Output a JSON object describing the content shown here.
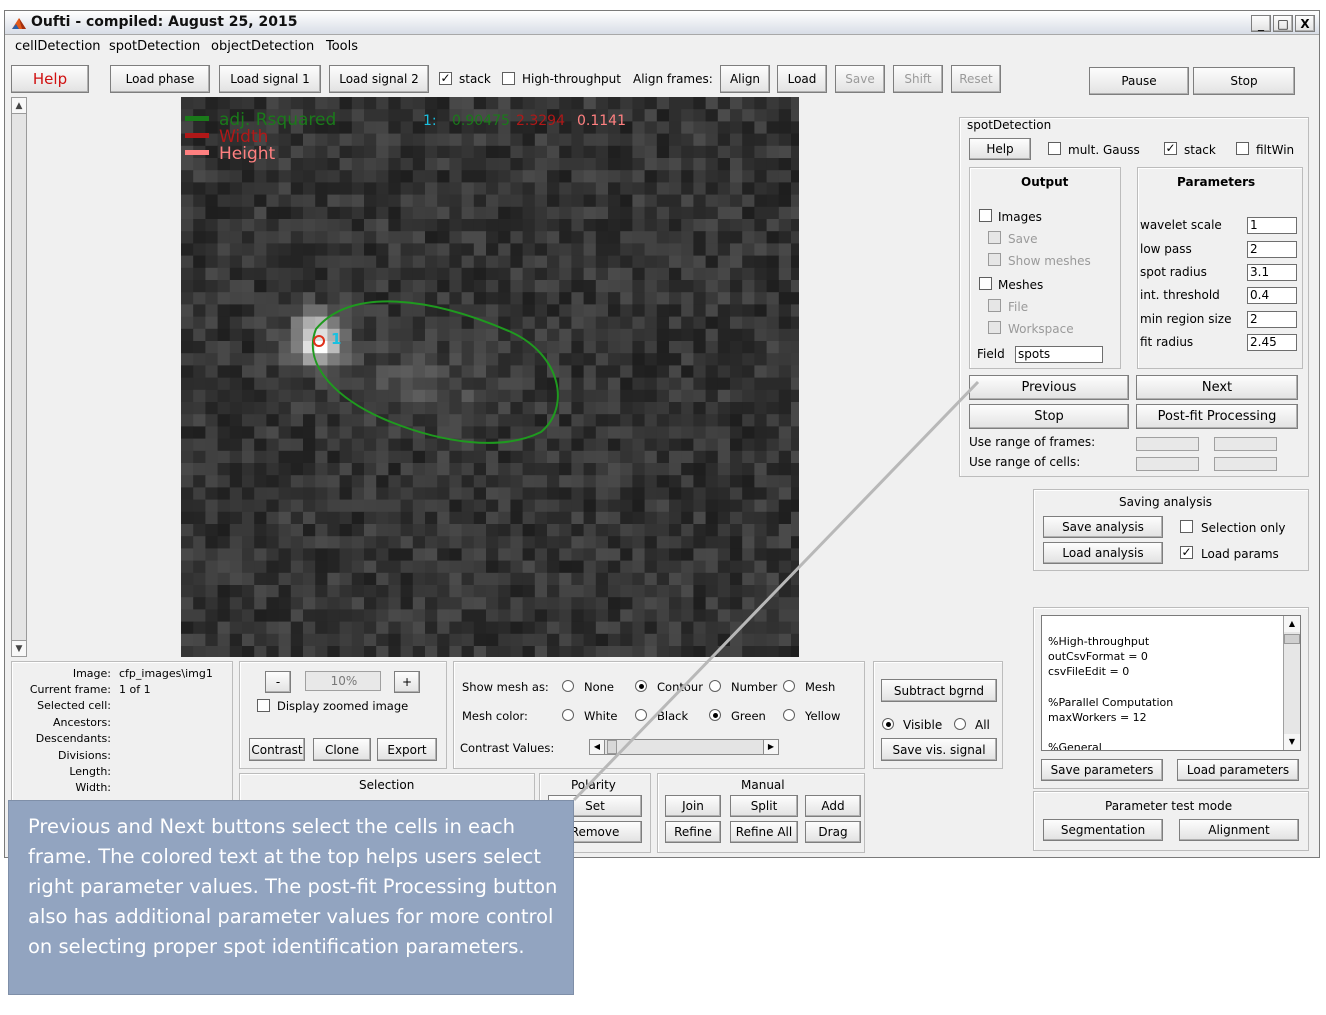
{
  "window": {
    "title": "Oufti - compiled:  August 25, 2015",
    "controls": {
      "minimize": "_",
      "maximize": "□",
      "close": "X"
    }
  },
  "menu": [
    "cellDetection",
    "spotDetection",
    "objectDetection",
    "Tools"
  ],
  "toolbar": {
    "help": "Help",
    "load_phase": "Load phase",
    "load_signal1": "Load signal 1",
    "load_signal2": "Load signal 2",
    "stack_label": "stack",
    "stack_checked": true,
    "high_throughput_label": "High-throughput",
    "high_throughput_checked": false,
    "align_frames_label": "Align frames:",
    "align": "Align",
    "load": "Load",
    "save": "Save",
    "shift": "Shift",
    "reset": "Reset",
    "pause": "Pause",
    "stop": "Stop"
  },
  "overlay": {
    "legend": [
      "adj. Rsquared",
      "Width",
      "Height"
    ],
    "legend_colors": [
      "#1a7a1a",
      "#b01818",
      "#ff8080"
    ],
    "spot_index": "1:",
    "val1": "0.90475",
    "val2": "2.3294",
    "val3": "0.1141",
    "spot_label": "1"
  },
  "spotDetection": {
    "panel_title": "spotDetection",
    "help": "Help",
    "mult_gauss": "mult. Gauss",
    "stack": "stack",
    "filtwin": "filtWin",
    "output": {
      "title": "Output",
      "images": "Images",
      "save": "Save",
      "show_meshes": "Show meshes",
      "meshes": "Meshes",
      "file": "File",
      "workspace": "Workspace",
      "field_label": "Field",
      "field_value": "spots"
    },
    "parameters": {
      "title": "Parameters",
      "rows": [
        {
          "label": "wavelet scale",
          "value": "1"
        },
        {
          "label": "low pass",
          "value": "2"
        },
        {
          "label": "spot radius",
          "value": "3.1"
        },
        {
          "label": "int. threshold",
          "value": "0.4"
        },
        {
          "label": "min region size",
          "value": "2"
        },
        {
          "label": "fit radius",
          "value": "2.45"
        }
      ]
    },
    "previous": "Previous",
    "next": "Next",
    "stop": "Stop",
    "post_fit": "Post-fit Processing",
    "range_frames": "Use range of frames:",
    "range_cells": "Use range of cells:"
  },
  "saving": {
    "title": "Saving analysis",
    "save_analysis": "Save analysis",
    "load_analysis": "Load analysis",
    "selection_only": "Selection only",
    "load_params": "Load params"
  },
  "params_text": [
    "%High-throughput",
    "outCsvFormat = 0",
    "csvFileEdit = 0",
    "",
    "%Parallel Computation",
    "maxWorkers = 12",
    "",
    "%General"
  ],
  "params_buttons": {
    "save": "Save parameters",
    "load": "Load parameters"
  },
  "test_mode": {
    "title": "Parameter test mode",
    "segmentation": "Segmentation",
    "alignment": "Alignment"
  },
  "info": {
    "image_label": "Image:",
    "image_value": "cfp_images\\img1",
    "frame_label": "Current frame:",
    "frame_value": "1 of 1",
    "selected_label": "Selected cell:",
    "ancestors_label": "Ancestors:",
    "descendants_label": "Descendants:",
    "divisions_label": "Divisions:",
    "length_label": "Length:",
    "width_label": "Width:"
  },
  "zoom": {
    "minus": "-",
    "value": "10%",
    "plus": "+",
    "display_zoomed": "Display zoomed image",
    "contrast": "Contrast",
    "clone": "Clone",
    "export": "Export"
  },
  "mesh": {
    "show_as_label": "Show mesh as:",
    "show_options": [
      "None",
      "Contour",
      "Number",
      "Mesh"
    ],
    "color_label": "Mesh color:",
    "color_options": [
      "White",
      "Black",
      "Green",
      "Yellow"
    ],
    "contrast_label": "Contrast Values:"
  },
  "bgrnd": {
    "subtract": "Subtract bgrnd",
    "visible": "Visible",
    "all": "All",
    "save_vis": "Save vis. signal"
  },
  "bottom": {
    "selection_title": "Selection",
    "polarity_title": "Polarity",
    "set": "Set",
    "remove": "Remove",
    "manual_title": "Manual",
    "join": "Join",
    "split": "Split",
    "add": "Add",
    "refine": "Refine",
    "refine_all": "Refine All",
    "drag": "Drag"
  },
  "callout": "Previous and Next buttons select the cells in each frame.  The colored text at the top helps users select right parameter values.  The post-fit Processing button also has additional  parameter values for more control on selecting proper spot identification parameters."
}
